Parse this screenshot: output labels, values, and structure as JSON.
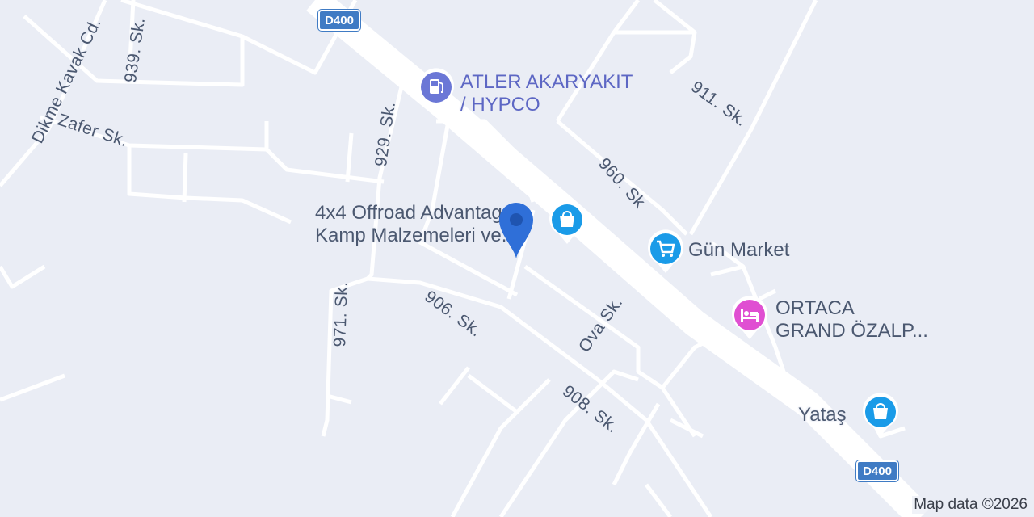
{
  "map": {
    "colors": {
      "background": "#eaedf5",
      "road": "#ffffff",
      "label": "#4b5870",
      "shield": "#3f7bc4",
      "fuel_pin": "#6b77d6",
      "shop_pin": "#1a9be8",
      "hotel_pin": "#e04fd2",
      "location_marker": "#2f6fd8"
    },
    "shields": [
      {
        "label": "D400"
      },
      {
        "label": "D400"
      }
    ],
    "streets": [
      "Dikme Kavak Cd.",
      "939. Sk.",
      "929. Sk.",
      "Zafer Sk.",
      "971. Sk.",
      "906. Sk.",
      "Ova Sk.",
      "908. Sk.",
      "960. Sk",
      "911. Sk."
    ],
    "pois": [
      {
        "name_line1": "ATLER AKARYAKIT",
        "name_line2": "/ HYPCO",
        "icon": "fuel-icon"
      },
      {
        "name_line1": "4x4 Offroad Advantage",
        "name_line2": "Kamp Malzemeleri ve...",
        "icon": "shopping-bag-icon"
      },
      {
        "name_line1": "Gün Market",
        "icon": "shopping-cart-icon"
      },
      {
        "name_line1": "ORTACA",
        "name_line2": "GRAND ÖZALP...",
        "icon": "bed-icon"
      },
      {
        "name_line1": "Yataş",
        "icon": "shopping-bag-icon"
      }
    ],
    "attribution": "Map data ©2026"
  }
}
